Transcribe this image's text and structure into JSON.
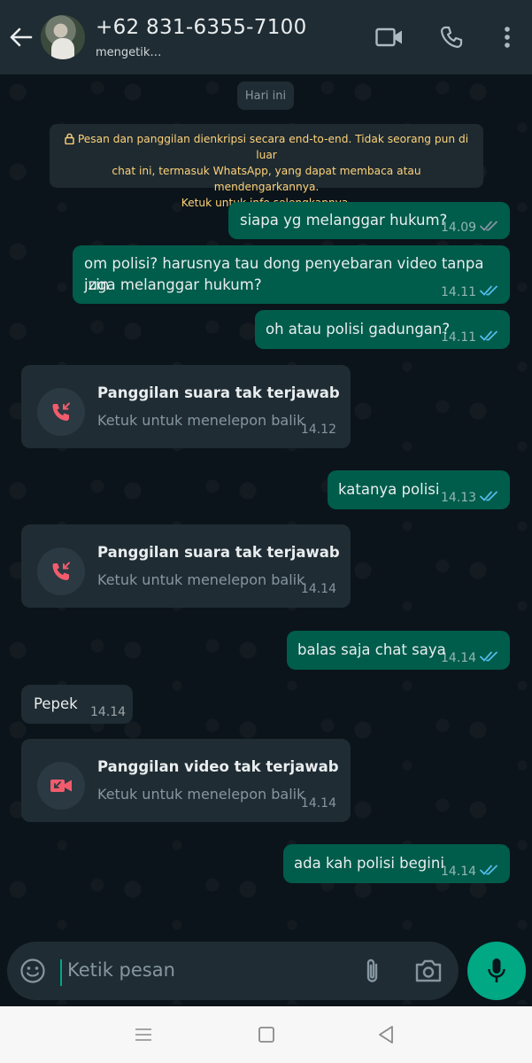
{
  "header": {
    "contact_name": "+62 831-6355-7100",
    "status": "mengetik…"
  },
  "chat": {
    "date_chip": "Hari ini",
    "encryption_notice_lines": [
      "Pesan dan panggilan dienkripsi secara end-to-end. Tidak seorang pun di luar",
      "chat ini, termasuk WhatsApp, yang dapat membaca atau mendengarkannya.",
      "Ketuk untuk info selengkapnya."
    ],
    "messages": [
      {
        "type": "out",
        "lines": [
          "siapa yg melanggar hukum?"
        ],
        "time": "14.09",
        "status": "delivered"
      },
      {
        "type": "out",
        "lines": [
          "om polisi? harusnya tau dong penyebaran video tanpa izin",
          "juga melanggar hukum?"
        ],
        "time": "14.11",
        "status": "read"
      },
      {
        "type": "out",
        "lines": [
          "oh atau polisi gadungan?"
        ],
        "time": "14.11",
        "status": "read"
      },
      {
        "type": "call",
        "title": "Panggilan suara tak terjawab",
        "subtitle": "Ketuk untuk menelepon balik",
        "time": "14.12",
        "icon": "missed-voice-call-icon"
      },
      {
        "type": "out",
        "lines": [
          "katanya polisi"
        ],
        "time": "14.13",
        "status": "read"
      },
      {
        "type": "call",
        "title": "Panggilan suara tak terjawab",
        "subtitle": "Ketuk untuk menelepon balik",
        "time": "14.14",
        "icon": "missed-voice-call-icon"
      },
      {
        "type": "out",
        "lines": [
          "balas saja chat saya"
        ],
        "time": "14.14",
        "status": "read"
      },
      {
        "type": "in",
        "lines": [
          "Pepek"
        ],
        "time": "14.14"
      },
      {
        "type": "call",
        "title": "Panggilan video tak terjawab",
        "subtitle": "Ketuk untuk menelepon balik",
        "time": "14.14",
        "icon": "missed-video-call-icon"
      },
      {
        "type": "out",
        "lines": [
          "ada kah polisi begini"
        ],
        "time": "14.14",
        "status": "read"
      }
    ]
  },
  "composer": {
    "placeholder": "Ketik pesan"
  },
  "colors": {
    "header_bg": "#1f2c33",
    "chat_bg": "#0b141a",
    "outgoing_bubble": "#005c4b",
    "incoming_bubble": "#1f2c33",
    "accent_green": "#00a884",
    "read_ticks": "#53bdeb",
    "missed_call_red": "#f15c6d",
    "encryption_text": "#ffd279"
  }
}
